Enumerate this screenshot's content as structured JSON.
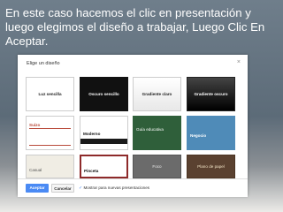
{
  "slide": {
    "caption": "En este caso hacemos el clic en presentación y luego elegimos el diseño a trabajar, Luego Clic En Aceptar."
  },
  "dialog": {
    "title": "Elige un diseño",
    "close_icon": "×",
    "themes": [
      {
        "label": "Luz sencilla"
      },
      {
        "label": "Oscuro sencillo"
      },
      {
        "label": "Gradiente claro"
      },
      {
        "label": "Gradiente oscuro"
      },
      {
        "label": "Suizo"
      },
      {
        "label": "Moderno"
      },
      {
        "label": "Guía educativa"
      },
      {
        "label": "Negocio"
      },
      {
        "label": "Casual"
      },
      {
        "label": "Pinceta"
      },
      {
        "label": "Foco"
      },
      {
        "label": "Plano de papel"
      }
    ],
    "accept_label": "Aceptar",
    "cancel_label": "Cancelar",
    "show_label": "Mostrar para nuevas presentaciones",
    "show_checked": true
  },
  "colors": {
    "accent": "#4a8af4",
    "suizo": "#b94a3a",
    "guia": "#2f5f3a",
    "negocio": "#4f8bb8"
  }
}
